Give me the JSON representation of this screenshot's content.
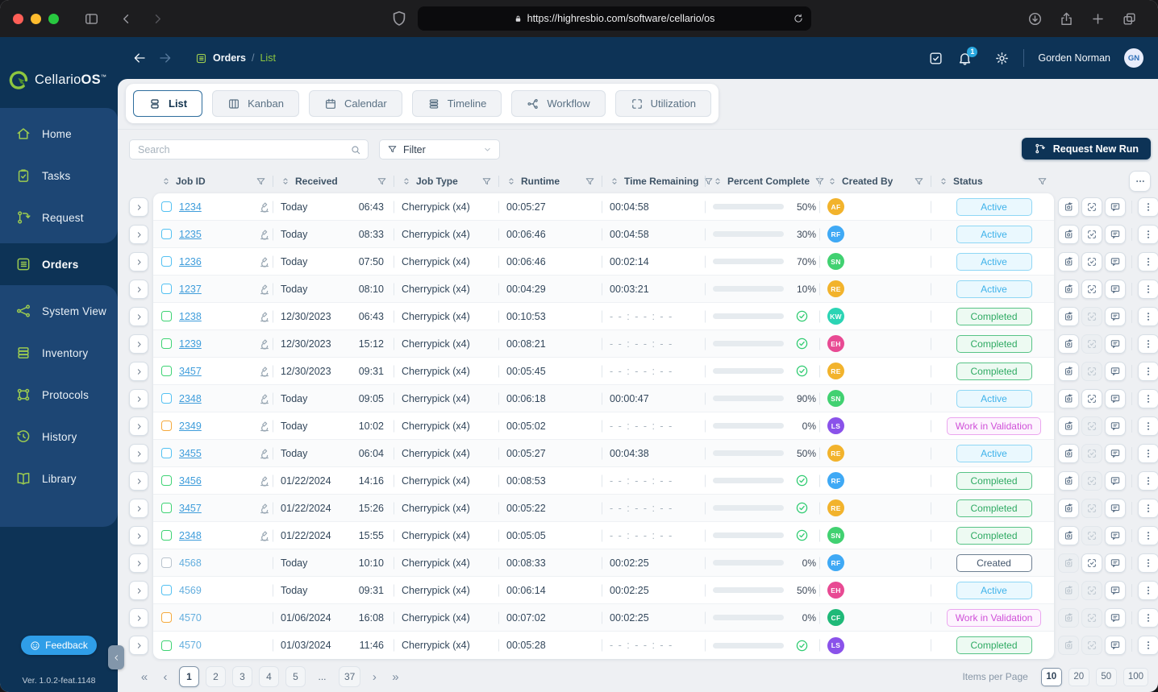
{
  "browser": {
    "url": "https://highresbio.com/software/cellario/os"
  },
  "header": {
    "breadcrumb": {
      "section": "Orders",
      "page": "List"
    },
    "notification_count": "1",
    "user_name": "Gorden Norman",
    "user_initials": "GN"
  },
  "sidebar": {
    "brand": "Cellario",
    "brand_bold": "OS",
    "brand_tm": "™",
    "items": [
      {
        "label": "Home",
        "icon": "home",
        "active": false
      },
      {
        "label": "Tasks",
        "icon": "tasks",
        "active": false
      },
      {
        "label": "Request",
        "icon": "request",
        "active": false
      },
      {
        "label": "Orders",
        "icon": "orders",
        "active": true
      },
      {
        "label": "System View",
        "icon": "system",
        "active": false
      },
      {
        "label": "Inventory",
        "icon": "inventory",
        "active": false
      },
      {
        "label": "Protocols",
        "icon": "protocols",
        "active": false
      },
      {
        "label": "History",
        "icon": "history",
        "active": false
      },
      {
        "label": "Library",
        "icon": "library",
        "active": false
      }
    ],
    "feedback_label": "Feedback",
    "version": "Ver. 1.0.2-feat.1148"
  },
  "tabs": [
    {
      "label": "List",
      "icon": "tab-list",
      "active": true
    },
    {
      "label": "Kanban",
      "icon": "tab-kanban",
      "active": false
    },
    {
      "label": "Calendar",
      "icon": "tab-calendar",
      "active": false
    },
    {
      "label": "Timeline",
      "icon": "tab-timeline",
      "active": false
    },
    {
      "label": "Workflow",
      "icon": "tab-workflow",
      "active": false
    },
    {
      "label": "Utilization",
      "icon": "tab-utilization",
      "active": false
    }
  ],
  "toolbar": {
    "search_placeholder": "Search",
    "filter_label": "Filter",
    "request_button": "Request New Run"
  },
  "table": {
    "columns": [
      "Job ID",
      "Received",
      "Job Type",
      "Runtime",
      "Time Remaining",
      "Percent Complete",
      "Created By",
      "Status"
    ],
    "rows": [
      {
        "id": "1234",
        "linked": true,
        "checkbox": "blue",
        "scope": true,
        "date": "Today",
        "time": "06:43",
        "type": "Cherrypick (x4)",
        "runtime": "00:05:27",
        "remaining": "00:04:58",
        "percent": 50,
        "done": false,
        "creator": {
          "initials": "AF",
          "color": "#F2B32C"
        },
        "status": {
          "label": "Active",
          "type": "active"
        },
        "actions": {
          "run": true,
          "validate": true,
          "comment": true
        }
      },
      {
        "id": "1235",
        "linked": true,
        "checkbox": "blue",
        "scope": true,
        "date": "Today",
        "time": "08:33",
        "type": "Cherrypick (x4)",
        "runtime": "00:06:46",
        "remaining": "00:04:58",
        "percent": 30,
        "done": false,
        "creator": {
          "initials": "RF",
          "color": "#3FA9F5"
        },
        "status": {
          "label": "Active",
          "type": "active"
        },
        "actions": {
          "run": true,
          "validate": true,
          "comment": true
        }
      },
      {
        "id": "1236",
        "linked": true,
        "checkbox": "blue",
        "scope": true,
        "date": "Today",
        "time": "07:50",
        "type": "Cherrypick (x4)",
        "runtime": "00:06:46",
        "remaining": "00:02:14",
        "percent": 70,
        "done": false,
        "creator": {
          "initials": "SN",
          "color": "#41D171"
        },
        "status": {
          "label": "Active",
          "type": "active"
        },
        "actions": {
          "run": true,
          "validate": true,
          "comment": true
        }
      },
      {
        "id": "1237",
        "linked": true,
        "checkbox": "blue",
        "scope": true,
        "date": "Today",
        "time": "08:10",
        "type": "Cherrypick (x4)",
        "runtime": "00:04:29",
        "remaining": "00:03:21",
        "percent": 10,
        "done": false,
        "creator": {
          "initials": "RE",
          "color": "#F2B32C"
        },
        "status": {
          "label": "Active",
          "type": "active"
        },
        "actions": {
          "run": true,
          "validate": true,
          "comment": true
        }
      },
      {
        "id": "1238",
        "linked": true,
        "checkbox": "green",
        "scope": true,
        "date": "12/30/2023",
        "time": "06:43",
        "type": "Cherrypick (x4)",
        "runtime": "00:10:53",
        "remaining": "--:--:--",
        "percent": 100,
        "done": true,
        "creator": {
          "initials": "KW",
          "color": "#2BD4B4"
        },
        "status": {
          "label": "Completed",
          "type": "completed"
        },
        "actions": {
          "run": true,
          "validate": false,
          "comment": true
        }
      },
      {
        "id": "1239",
        "linked": true,
        "checkbox": "green",
        "scope": true,
        "date": "12/30/2023",
        "time": "15:12",
        "type": "Cherrypick (x4)",
        "runtime": "00:08:21",
        "remaining": "--:--:--",
        "percent": 100,
        "done": true,
        "creator": {
          "initials": "EH",
          "color": "#E84A93"
        },
        "status": {
          "label": "Completed",
          "type": "completed"
        },
        "actions": {
          "run": true,
          "validate": false,
          "comment": true
        }
      },
      {
        "id": "3457",
        "linked": true,
        "checkbox": "green",
        "scope": true,
        "date": "12/30/2023",
        "time": "09:31",
        "type": "Cherrypick (x4)",
        "runtime": "00:05:45",
        "remaining": "--:--:--",
        "percent": 100,
        "done": true,
        "creator": {
          "initials": "RE",
          "color": "#F2B32C"
        },
        "status": {
          "label": "Completed",
          "type": "completed"
        },
        "actions": {
          "run": true,
          "validate": false,
          "comment": true
        }
      },
      {
        "id": "2348",
        "linked": true,
        "checkbox": "blue",
        "scope": true,
        "date": "Today",
        "time": "09:05",
        "type": "Cherrypick (x4)",
        "runtime": "00:06:18",
        "remaining": "00:00:47",
        "percent": 90,
        "done": false,
        "creator": {
          "initials": "SN",
          "color": "#41D171"
        },
        "status": {
          "label": "Active",
          "type": "active"
        },
        "actions": {
          "run": true,
          "validate": true,
          "comment": true
        }
      },
      {
        "id": "2349",
        "linked": true,
        "checkbox": "orange",
        "scope": true,
        "date": "Today",
        "time": "10:02",
        "type": "Cherrypick (x4)",
        "runtime": "00:05:02",
        "remaining": "--:--:--",
        "percent": 0,
        "done": false,
        "creator": {
          "initials": "LS",
          "color": "#8A52EA"
        },
        "status": {
          "label": "Work in Validation",
          "type": "validation"
        },
        "actions": {
          "run": true,
          "validate": false,
          "comment": true
        }
      },
      {
        "id": "3455",
        "linked": true,
        "checkbox": "blue",
        "scope": true,
        "date": "Today",
        "time": "06:04",
        "type": "Cherrypick (x4)",
        "runtime": "00:05:27",
        "remaining": "00:04:38",
        "percent": 50,
        "done": false,
        "creator": {
          "initials": "RE",
          "color": "#F2B32C"
        },
        "status": {
          "label": "Active",
          "type": "active"
        },
        "actions": {
          "run": true,
          "validate": false,
          "comment": true
        }
      },
      {
        "id": "3456",
        "linked": true,
        "checkbox": "green",
        "scope": true,
        "date": "01/22/2024",
        "time": "14:16",
        "type": "Cherrypick (x4)",
        "runtime": "00:08:53",
        "remaining": "--:--:--",
        "percent": 100,
        "done": true,
        "creator": {
          "initials": "RF",
          "color": "#3FA9F5"
        },
        "status": {
          "label": "Completed",
          "type": "completed"
        },
        "actions": {
          "run": true,
          "validate": false,
          "comment": true
        }
      },
      {
        "id": "3457",
        "linked": true,
        "checkbox": "green",
        "scope": true,
        "date": "01/22/2024",
        "time": "15:26",
        "type": "Cherrypick (x4)",
        "runtime": "00:05:22",
        "remaining": "--:--:--",
        "percent": 100,
        "done": true,
        "creator": {
          "initials": "RE",
          "color": "#F2B32C"
        },
        "status": {
          "label": "Completed",
          "type": "completed"
        },
        "actions": {
          "run": true,
          "validate": false,
          "comment": true
        }
      },
      {
        "id": "2348",
        "linked": true,
        "checkbox": "green",
        "scope": true,
        "date": "01/22/2024",
        "time": "15:55",
        "type": "Cherrypick (x4)",
        "runtime": "00:05:05",
        "remaining": "--:--:--",
        "percent": 100,
        "done": true,
        "creator": {
          "initials": "SN",
          "color": "#41D171"
        },
        "status": {
          "label": "Completed",
          "type": "completed"
        },
        "actions": {
          "run": true,
          "validate": false,
          "comment": true
        }
      },
      {
        "id": "4568",
        "linked": false,
        "checkbox": "gray",
        "scope": false,
        "date": "Today",
        "time": "10:10",
        "type": "Cherrypick (x4)",
        "runtime": "00:08:33",
        "remaining": "00:02:25",
        "percent": 0,
        "done": false,
        "creator": {
          "initials": "RF",
          "color": "#3FA9F5"
        },
        "status": {
          "label": "Created",
          "type": "created"
        },
        "actions": {
          "run": false,
          "validate": true,
          "comment": true
        }
      },
      {
        "id": "4569",
        "linked": false,
        "checkbox": "blue",
        "scope": false,
        "date": "Today",
        "time": "09:31",
        "type": "Cherrypick (x4)",
        "runtime": "00:06:14",
        "remaining": "00:02:25",
        "percent": 50,
        "done": false,
        "creator": {
          "initials": "EH",
          "color": "#E84A93"
        },
        "status": {
          "label": "Active",
          "type": "active"
        },
        "actions": {
          "run": false,
          "validate": false,
          "comment": true
        }
      },
      {
        "id": "4570",
        "linked": false,
        "checkbox": "orange",
        "scope": false,
        "date": "01/06/2024",
        "time": "16:08",
        "type": "Cherrypick (x4)",
        "runtime": "00:07:02",
        "remaining": "00:02:25",
        "percent": 0,
        "done": false,
        "creator": {
          "initials": "CF",
          "color": "#1FB978"
        },
        "status": {
          "label": "Work in Validation",
          "type": "validation"
        },
        "actions": {
          "run": false,
          "validate": false,
          "comment": true
        }
      },
      {
        "id": "4570",
        "linked": false,
        "checkbox": "green",
        "scope": false,
        "date": "01/03/2024",
        "time": "11:46",
        "type": "Cherrypick (x4)",
        "runtime": "00:05:28",
        "remaining": "--:--:--",
        "percent": 100,
        "done": true,
        "creator": {
          "initials": "LS",
          "color": "#8A52EA"
        },
        "status": {
          "label": "Completed",
          "type": "completed"
        },
        "actions": {
          "run": false,
          "validate": false,
          "comment": true
        }
      }
    ]
  },
  "pagination": {
    "pages": [
      "1",
      "2",
      "3",
      "4",
      "5",
      "...",
      "37"
    ],
    "active_page": "1",
    "items_per_page_label": "Items per Page",
    "page_sizes": [
      "10",
      "20",
      "50",
      "100"
    ],
    "active_size": "10"
  },
  "colors": {
    "navy": "#0d3356",
    "sidebar_panel": "#1d4674",
    "green_accent": "#8dc63f",
    "progress_blue": "#45b0ea",
    "progress_green": "#2ecb70",
    "status_active": "#3eb2ea",
    "status_completed": "#2faa63",
    "status_validation": "#cf4fd8",
    "status_created": "#42556b",
    "link_blue": "#3f9ddb",
    "feedback_blue": "#2f9ee8"
  }
}
